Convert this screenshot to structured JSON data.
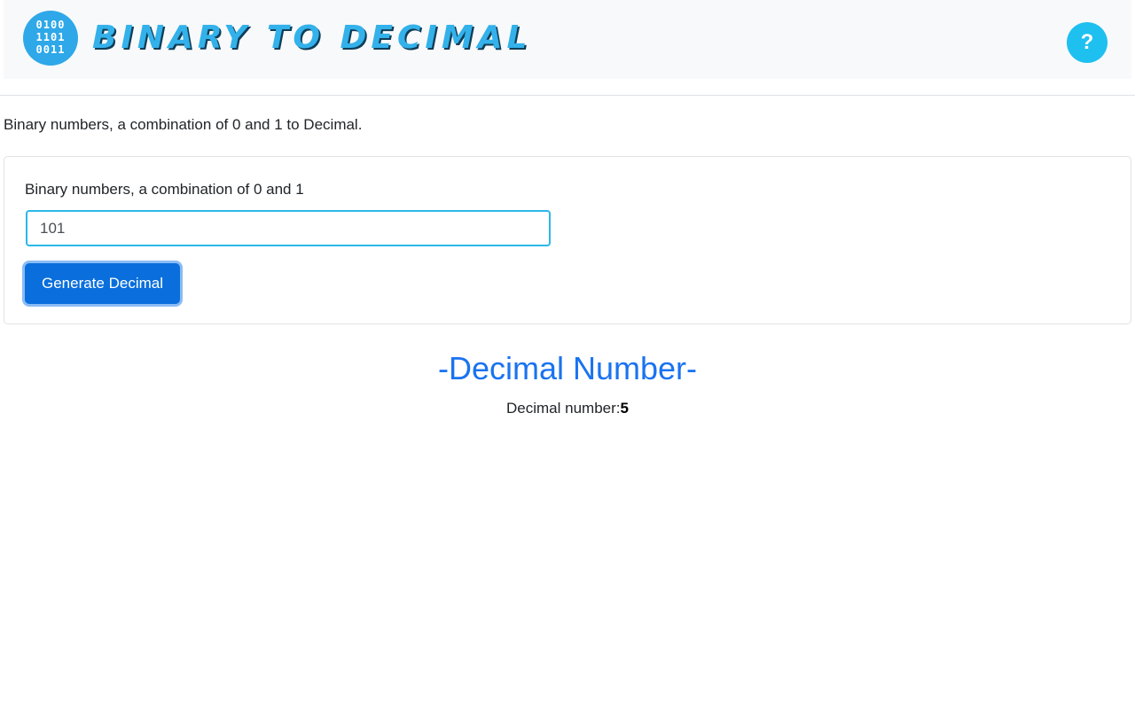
{
  "header": {
    "logo_digits": [
      "0100",
      "1101",
      "0011"
    ],
    "title": "BINARY TO DECIMAL",
    "help_label": "?",
    "colors": {
      "brand": "#33b1ea",
      "help": "#1ec0f0"
    }
  },
  "intro": {
    "text": "Binary numbers, a combination of 0 and 1 to Decimal."
  },
  "form": {
    "label": "Binary numbers, a combination of 0 and 1",
    "input_value": "101",
    "button_label": "Generate Decimal",
    "colors": {
      "button": "#0a6fdc",
      "input_border": "#2bb8ea"
    }
  },
  "result": {
    "heading": "-Decimal Number-",
    "label": "Decimal number:",
    "value": "5",
    "colors": {
      "heading": "#1a73f0"
    }
  }
}
